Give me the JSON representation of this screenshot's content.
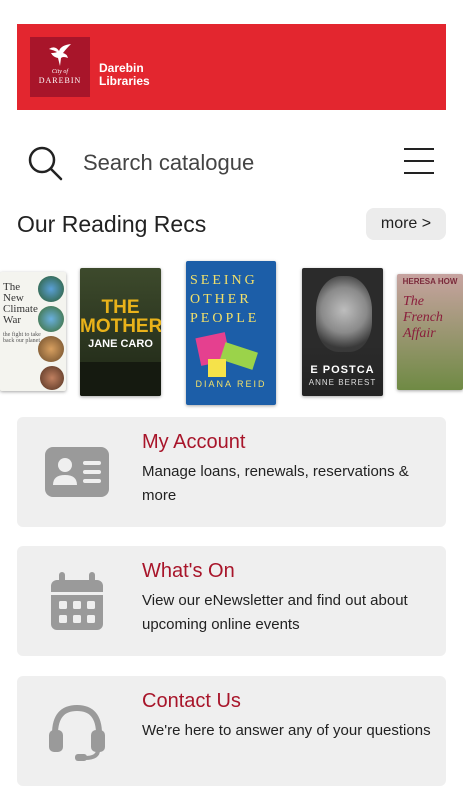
{
  "header": {
    "logo_city": "City of",
    "logo_name": "DAREBIN",
    "brand_line1": "Darebin",
    "brand_line2": "Libraries"
  },
  "search": {
    "placeholder": "Search catalogue"
  },
  "recs": {
    "title": "Our Reading Recs",
    "more_label": "more >",
    "books": [
      {
        "title_lines": [
          "The",
          "New",
          "Climate",
          "War"
        ],
        "subtitle": "the fight to take back our planet"
      },
      {
        "title": "THE MOTHER",
        "author": "JANE CARO"
      },
      {
        "title": "SEEING OTHER PEOPLE",
        "author": "DIANA REID"
      },
      {
        "title": "E POSTCA",
        "author": "ANNE BEREST"
      },
      {
        "title": "The French Affair",
        "author": "HERESA HOW"
      }
    ]
  },
  "cards": [
    {
      "title": "My Account",
      "description": "Manage loans, renewals, reservations & more",
      "icon": "id-card-icon"
    },
    {
      "title": "What's On",
      "description": "View our eNewsletter and find out about upcoming online events",
      "icon": "calendar-icon"
    },
    {
      "title": "Contact Us",
      "description": "We're here to answer any of your questions",
      "icon": "headset-icon"
    }
  ],
  "colors": {
    "brand_red": "#e3262f",
    "accent": "#a8152a"
  }
}
